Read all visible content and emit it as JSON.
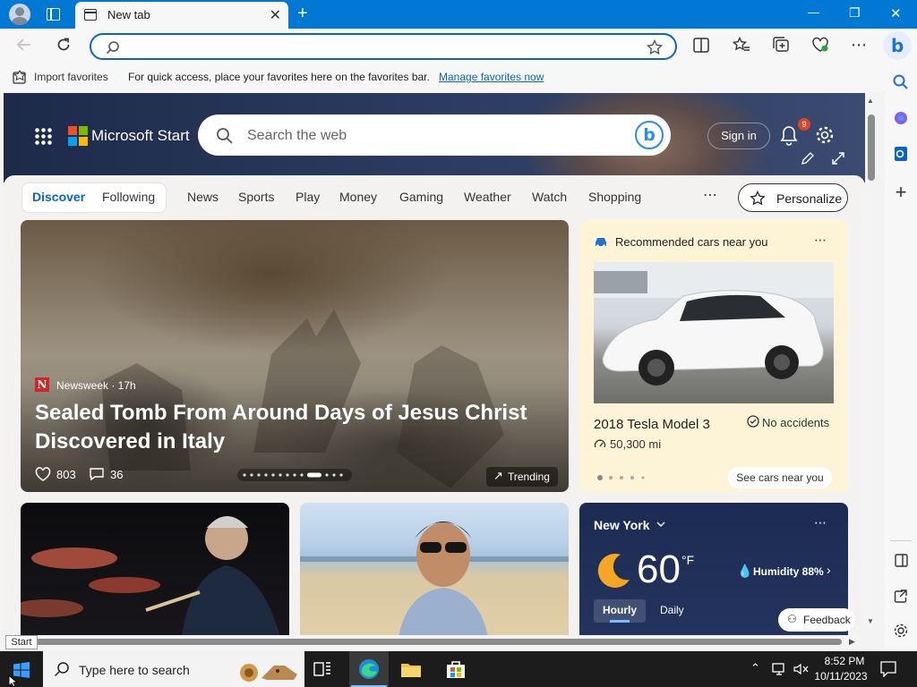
{
  "browser": {
    "tab_title": "New tab",
    "tab_close": "✕",
    "new_tab": "+",
    "minimize": "—",
    "restore": "❐",
    "close": "✕",
    "address_value": "",
    "more": "⋯"
  },
  "favorites_bar": {
    "import_label": "Import favorites",
    "message": "For quick access, place your favorites here on the favorites bar.",
    "manage_link": "Manage favorites now"
  },
  "start_page": {
    "brand": "Microsoft Start",
    "search_placeholder": "Search the web",
    "sign_in": "Sign in",
    "notification_count": "9",
    "nav": {
      "discover": "Discover",
      "following": "Following",
      "items": [
        "News",
        "Sports",
        "Play",
        "Money",
        "Gaming",
        "Weather",
        "Watch",
        "Shopping"
      ],
      "more": "⋯",
      "personalize": "Personalize"
    },
    "main_story": {
      "source_logo": "N",
      "source": "Newsweek · 17h",
      "headline": "Sealed Tomb From Around Days of Jesus Christ Discovered in Italy",
      "likes": "803",
      "comments": "36",
      "trending": "Trending"
    },
    "cars_card": {
      "title": "Recommended cars near you",
      "more": "⋯",
      "model": "2018 Tesla Model 3",
      "badge": "No accidents",
      "mileage": "50,300 mi",
      "cta": "See cars near you"
    },
    "weather_card": {
      "city": "New York",
      "more": "⋯",
      "temperature": "60",
      "unit": "°F",
      "humidity": "Humidity 88%",
      "tab_hourly": "Hourly",
      "tab_daily": "Daily",
      "feedback": "Feedback"
    }
  },
  "taskbar": {
    "search_placeholder": "Type here to search",
    "start_tooltip": "Start",
    "time": "8:52 PM",
    "date": "10/11/2023"
  },
  "colors": {
    "accent": "#0078d4",
    "link": "#0a64c8",
    "badge": "#d9442a",
    "cars_card_bg": "#fdf3d6"
  }
}
